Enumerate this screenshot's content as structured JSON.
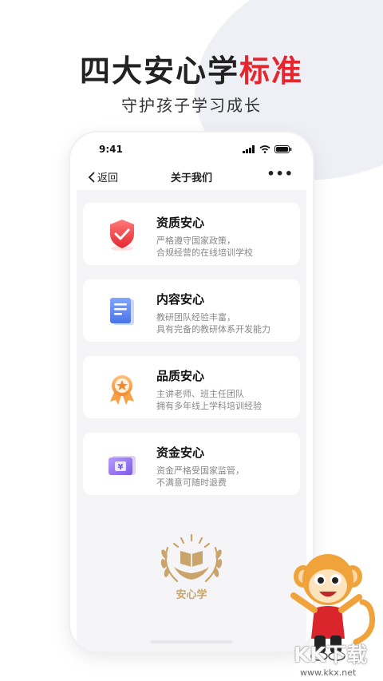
{
  "headline": {
    "main": "四大安心学",
    "accent": "标准"
  },
  "subtitle": "守护孩子学习成长",
  "status_bar": {
    "time": "9:41"
  },
  "nav": {
    "back_label": "返回",
    "title": "关于我们",
    "more": "•••"
  },
  "cards": [
    {
      "title": "资质安心",
      "line1": "严格遵守国家政策，",
      "line2": "合规经营的在线培训学校",
      "icon": "shield-check-icon"
    },
    {
      "title": "内容安心",
      "line1": "教研团队经验丰富，",
      "line2": "具有完备的教研体系开发能力",
      "icon": "document-icon"
    },
    {
      "title": "品质安心",
      "line1": "主讲老师、班主任团队",
      "line2": "拥有多年线上学科培训经验",
      "icon": "medal-icon"
    },
    {
      "title": "资金安心",
      "line1": "资金严格受国家监管，",
      "line2": "不满意可随时退费",
      "icon": "wallet-yuan-icon"
    }
  ],
  "badge_text": "安心学",
  "watermark": {
    "text": "KK下载",
    "url": "www.kkx.net"
  },
  "colors": {
    "accent": "#e5262e",
    "gold": "#c9a46b",
    "content_bg": "#f5f5f7"
  }
}
